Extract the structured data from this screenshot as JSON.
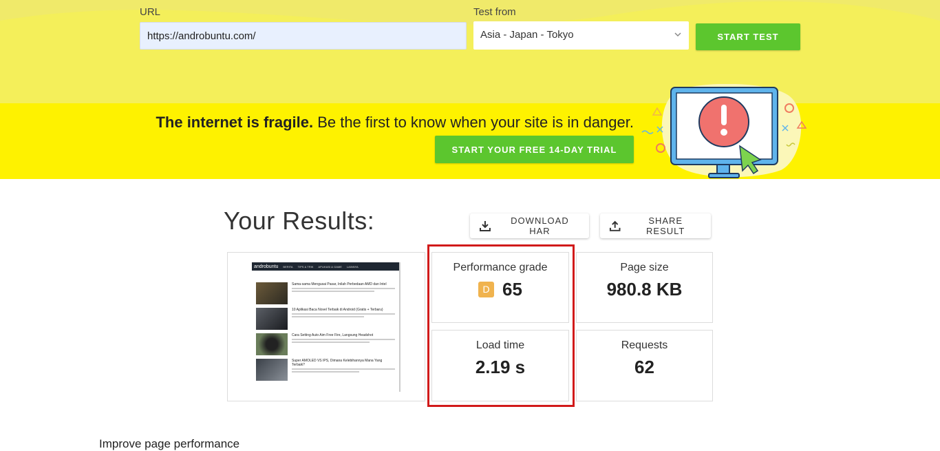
{
  "form": {
    "url_label": "URL",
    "url_value": "https://androbuntu.com/",
    "test_from_label": "Test from",
    "test_from_value": "Asia - Japan - Tokyo",
    "start_button": "START TEST"
  },
  "banner": {
    "bold_text": "The internet is fragile.",
    "text": " Be the first to know when your site is in danger.",
    "trial_button": "START YOUR FREE 14-DAY TRIAL"
  },
  "results": {
    "title": "Your Results:",
    "download_button": "DOWNLOAD HAR",
    "share_button": "SHARE RESULT",
    "performance": {
      "label": "Performance grade",
      "grade": "D",
      "score": "65"
    },
    "page_size": {
      "label": "Page size",
      "value": "980.8 KB"
    },
    "load_time": {
      "label": "Load time",
      "value": "2.19 s"
    },
    "requests": {
      "label": "Requests",
      "value": "62"
    }
  },
  "thumbnail": {
    "logo": "androbuntu",
    "nav": [
      "BERITA",
      "TIPS & TRIK",
      "APLIKASI & GAME",
      "LAINNYA"
    ],
    "articles": [
      "Sama-sama Mengusai Pasar, Inilah Perbedaan AMD dan Intel",
      "10 Aplikasi Baca Novel Terbaik di Android (Gratis + Terbaru)",
      "Cara Setting Auto Aim Free Fire, Langsung Headshot",
      "Super AMOLED VS IPS, Dimana Kelebihannya Mana Yang Terbaik?"
    ]
  },
  "improve": {
    "label": "Improve page performance"
  },
  "colors": {
    "accent_green": "#5cc62e",
    "banner_yellow": "#fef200",
    "grade_d": "#f0b34e",
    "highlight_red": "#d11a1a"
  }
}
